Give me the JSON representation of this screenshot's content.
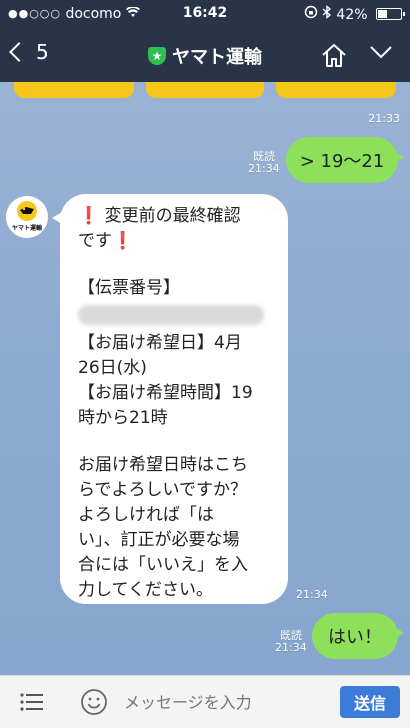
{
  "status_bar": {
    "signal_dots": "●●○○○",
    "carrier": "docomo",
    "time": "16:42",
    "battery": "42%"
  },
  "header": {
    "back_count": "5",
    "title": "ヤマト運輸"
  },
  "messages": {
    "first_time": "21:33",
    "reply1": {
      "read": "既読",
      "time": "21:34",
      "text": "> 19〜21"
    },
    "bot": {
      "avatar_text": "ヤマト運輸",
      "line1": "変更前の最終確認",
      "line2": "です",
      "line3": "【伝票番号】",
      "line4": "【お届け希望日】4月",
      "line5": "26日(水)",
      "line6": "【お届け希望時間】19",
      "line7": "時から21時",
      "line8": "お届け希望日時はこち",
      "line9": "らでよろしいですか？",
      "line10": "よろしければ「は",
      "line11": "い」、訂正が必要な場",
      "line12": "合には「いいえ」を入",
      "line13": "力してください。",
      "time": "21:34"
    },
    "reply2": {
      "read": "既読",
      "time": "21:34",
      "text": "はい！"
    }
  },
  "input_bar": {
    "placeholder": "メッセージを入力",
    "send_label": "送信"
  },
  "colors": {
    "header_bg": "#2a3449",
    "out_bubble": "#8ee05a",
    "send_button": "#3d7bd9",
    "quick_button": "#f6c61a"
  }
}
